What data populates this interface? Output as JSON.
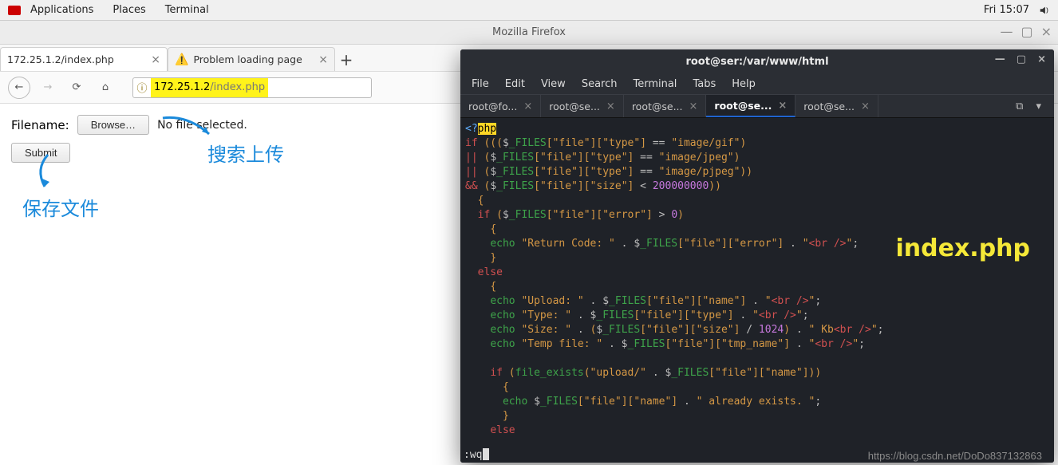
{
  "topbar": {
    "menu": [
      "Applications",
      "Places",
      "Terminal"
    ],
    "clock": "Fri 15:07"
  },
  "firefox": {
    "title": "Mozilla Firefox",
    "tabs": [
      {
        "label": "172.25.1.2/index.php"
      },
      {
        "label": "Problem loading page",
        "hasWarning": true
      }
    ],
    "url_host": "172.25.1.2",
    "url_path": "/index.php"
  },
  "page": {
    "filename_label": "Filename:",
    "browse_label": "Browse…",
    "nofile": "No file selected.",
    "submit_label": "Submit"
  },
  "annotations": {
    "search_upload": "搜索上传",
    "save_file": "保存文件"
  },
  "terminal": {
    "title": "root@ser:/var/www/html",
    "menubar": [
      "File",
      "Edit",
      "View",
      "Search",
      "Terminal",
      "Tabs",
      "Help"
    ],
    "tabs": [
      "root@fo...",
      "root@se...",
      "root@se...",
      "root@se...",
      "root@se..."
    ],
    "active_tab_index": 3,
    "overlay_label": "index.php",
    "status_cmd": ":wq",
    "code": {
      "php_open": "<?",
      "php_kw": "php",
      "if": "if",
      "or": "||",
      "and": "&&",
      "files_var": "_FILES",
      "k_file": "file",
      "k_type": "type",
      "k_size": "size",
      "k_error": "error",
      "k_name": "name",
      "k_tmp": "tmp_name",
      "v_gif": "image/gif",
      "v_jpeg": "image/jpeg",
      "v_pjpeg": "image/pjpeg",
      "size_limit": "200000000",
      "gt0": "0",
      "echo": "echo",
      "return_code": "Return Code: ",
      "br": "<br />",
      "else": "else",
      "upload": "Upload: ",
      "type_lbl": "Type: ",
      "size_lbl": "Size: ",
      "temp_lbl": "Temp file: ",
      "div1024": "1024",
      "kb": " Kb",
      "file_exists": "file_exists",
      "upload_path": "upload/",
      "already_exists": " already exists. "
    }
  },
  "watermark": "https://blog.csdn.net/DoDo837132863"
}
